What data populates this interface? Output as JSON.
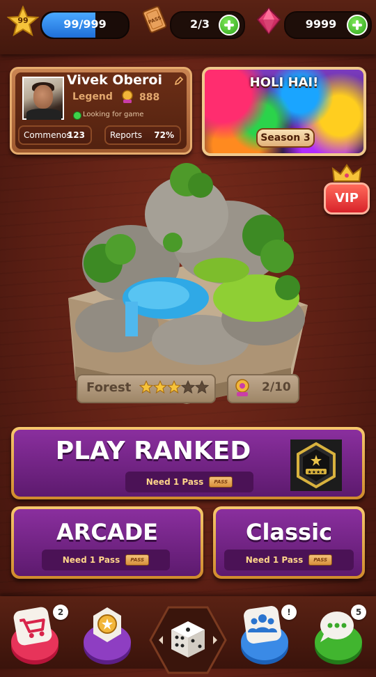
{
  "top_bar": {
    "level": "99",
    "xp_text": "99/999",
    "xp_progress": 0.62,
    "passes": "2/3",
    "pass_icon_label": "PASS",
    "gems": "9999"
  },
  "profile": {
    "name": "Vivek Oberoi",
    "rank": "Legend",
    "score": "888",
    "status": "Looking for game",
    "stats": [
      {
        "label": "Commenos",
        "value": "123"
      },
      {
        "label": "Reports",
        "value": "72%"
      }
    ]
  },
  "event": {
    "title": "HOLI HAI!",
    "season": "Season 3"
  },
  "vip_label": "VIP",
  "level_info": {
    "name": "Forest",
    "stars_earned": 3,
    "stars_total": 5,
    "trophy_progress": "2/10"
  },
  "modes": {
    "ranked": {
      "title": "PLAY RANKED",
      "requirement": "Need 1 Pass",
      "pass_label": "PASS"
    },
    "arcade": {
      "title": "ARCADE",
      "requirement": "Need 1 Pass",
      "pass_label": "PASS"
    },
    "classic": {
      "title": "Classic",
      "requirement": "Need 1 Pass",
      "pass_label": "PASS"
    }
  },
  "bottom_nav": {
    "shop_badge": "2",
    "friends_badge": "!",
    "chat_badge": "5"
  },
  "icons": [
    "star-icon",
    "pass-ticket-icon",
    "gem-icon",
    "plus-icon",
    "pencil-icon",
    "trophy-icon",
    "crown-icon",
    "cart-icon",
    "medal-icon",
    "dice-icon",
    "friends-icon",
    "chat-icon",
    "rank-badge-icon"
  ],
  "colors": {
    "accent_purple": "#6f2281",
    "gold_frame": "#f0b95c",
    "plus_green": "#2fa31a",
    "vip_red": "#d8232a"
  }
}
